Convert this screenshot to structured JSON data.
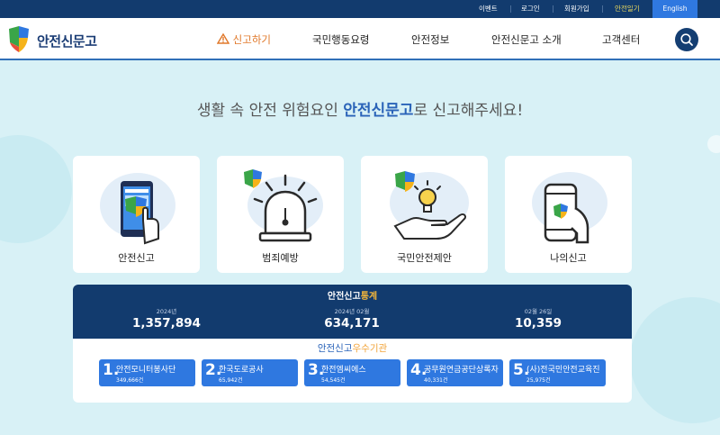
{
  "top_links": [
    "이벤트",
    "로그인",
    "회원가입",
    "안전일기",
    "English"
  ],
  "brand": {
    "name": "안전신문고"
  },
  "nav": [
    "신고하기",
    "국민행동요령",
    "안전정보",
    "안전신문고 소개",
    "고객센터"
  ],
  "hero": {
    "headline_pre": "생활 속 안전 위험요인 ",
    "headline_brand": "안전신문고",
    "headline_post": "로 신고해주세요!"
  },
  "cards": [
    {
      "label": "안전신고",
      "icon": "phone-report-icon"
    },
    {
      "label": "범죄예방",
      "icon": "siren-icon"
    },
    {
      "label": "국민안전제안",
      "icon": "lightbulb-hand-icon"
    },
    {
      "label": "나의신고",
      "icon": "my-phone-icon"
    }
  ],
  "stats": {
    "title_a": "안전신고",
    "title_b": "통계",
    "items": [
      {
        "period": "2024년",
        "value": "1,357,894"
      },
      {
        "period": "2024년 02월",
        "value": "634,171"
      },
      {
        "period": "02월 26일",
        "value": "10,359"
      }
    ]
  },
  "best": {
    "title_a": "안전신고",
    "title_b": "우수기관",
    "orgs": [
      {
        "rank": "1.",
        "name": "안전모니터봉사단",
        "count": "349,666건"
      },
      {
        "rank": "2.",
        "name": "한국도로공사",
        "count": "65,942건"
      },
      {
        "rank": "3.",
        "name": "한전엠씨에스",
        "count": "54,545건"
      },
      {
        "rank": "4.",
        "name": "공무원연금공단상록자",
        "count": "40,331건"
      },
      {
        "rank": "5.",
        "name": "(사)전국민안전교육진",
        "count": "25,975건"
      }
    ]
  },
  "colors": {
    "navy": "#123b6e",
    "accent_blue": "#2f78e0",
    "orange": "#e0782a",
    "gold": "#f2b53a",
    "bg": "#d8f1f6"
  }
}
